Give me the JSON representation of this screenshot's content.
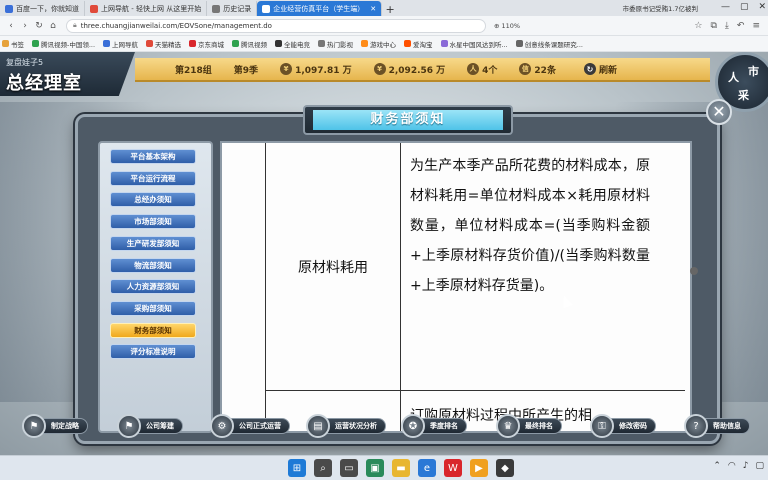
{
  "browser": {
    "tabs": [
      {
        "label": "百度一下，你就知道",
        "color": "#3a6fd8"
      },
      {
        "label": "上网导航 - 轻快上网 从这里开始",
        "color": "#e04a3a"
      },
      {
        "label": "历史记录",
        "color": "#777777"
      },
      {
        "label": "企业经营仿真平台（学生端）",
        "color": "#ffffff",
        "active": true
      }
    ],
    "news_text": "市委原书记受贿1.7亿被判",
    "url": "three.chuangjianweilai.com/EOVSone/management.do",
    "zoom": "110%",
    "bookmarks": [
      {
        "label": "书签",
        "color": "#e6a23c"
      },
      {
        "label": "腾讯视频-中国领...",
        "color": "#2fa24f"
      },
      {
        "label": "上网导航",
        "color": "#3a6fd8"
      },
      {
        "label": "天猫精选",
        "color": "#e04a3a"
      },
      {
        "label": "京东商城",
        "color": "#d9262c"
      },
      {
        "label": "腾讯视频",
        "color": "#2fa24f"
      },
      {
        "label": "全能电竞",
        "color": "#333333"
      },
      {
        "label": "热门影视",
        "color": "#777777"
      },
      {
        "label": "游戏中心",
        "color": "#ff8c1a"
      },
      {
        "label": "爱淘宝",
        "color": "#ff5000"
      },
      {
        "label": "水星中国风达到听...",
        "color": "#8a6ad8"
      },
      {
        "label": "创意线条课题研究...",
        "color": "#666666"
      }
    ]
  },
  "game": {
    "user_label": "复盘娃子5",
    "room_title": "总经理室",
    "stats": [
      {
        "label": "第218组",
        "icon": ""
      },
      {
        "label": "第9季",
        "icon": ""
      },
      {
        "label": "1,097.81 万",
        "icon": "¥"
      },
      {
        "label": "2,092.56 万",
        "icon": "¥"
      },
      {
        "label": "4个",
        "icon": "人"
      },
      {
        "label": "22条",
        "icon": "信"
      }
    ],
    "refresh_label": "刷新",
    "badge_chars": [
      "人",
      "市",
      "采"
    ]
  },
  "modal": {
    "title": "财务部须知",
    "close_glyph": "✕",
    "nav_items": [
      "平台基本架构",
      "平台运行流程",
      "总经办须知",
      "市场部须知",
      "生产研发部须知",
      "物流部须知",
      "人力资源部须知",
      "采购部须知",
      "财务部须知",
      "评分标准说明"
    ],
    "active_nav_index": 8,
    "row_label": "原材料耗用",
    "row_desc": "为生产本季产品所花费的材料成本，原材料耗用=单位材料成本×耗用原材料数量，单位材料成本=(当季购料金额+上季原材料存货价值)/(当季购料数量+上季原材料存货量)。",
    "next_row_text": "订购原材料过程中所产生的相"
  },
  "toolbar": [
    {
      "label": "制定战略",
      "icon": "flag-icon"
    },
    {
      "label": "公司筹建",
      "icon": "flag-icon"
    },
    {
      "label": "公司正式运营",
      "icon": "gear-icon"
    },
    {
      "label": "运营状况分析",
      "icon": "chart-icon"
    },
    {
      "label": "季度排名",
      "icon": "medal-icon"
    },
    {
      "label": "最终排名",
      "icon": "trophy-icon"
    },
    {
      "label": "修改密码",
      "icon": "lock-icon"
    },
    {
      "label": "帮助信息",
      "icon": "help-icon"
    }
  ],
  "taskbar": {
    "apps": [
      {
        "name": "windows-start-icon",
        "color": "#1e7ad6",
        "glyph": "⊞"
      },
      {
        "name": "search-icon",
        "color": "#4a4a4a",
        "glyph": "⌕"
      },
      {
        "name": "task-view-icon",
        "color": "#4a4a4a",
        "glyph": "▭"
      },
      {
        "name": "widgets-icon",
        "color": "#2a8a5a",
        "glyph": "▣"
      },
      {
        "name": "file-explorer-icon",
        "color": "#e8b630",
        "glyph": "▬"
      },
      {
        "name": "browser-icon",
        "color": "#2a78d6",
        "glyph": "e"
      },
      {
        "name": "wps-icon",
        "color": "#d9262c",
        "glyph": "W"
      },
      {
        "name": "media-icon",
        "color": "#f0a020",
        "glyph": "▶"
      },
      {
        "name": "app-icon",
        "color": "#3a3a3a",
        "glyph": "◆"
      }
    ]
  }
}
